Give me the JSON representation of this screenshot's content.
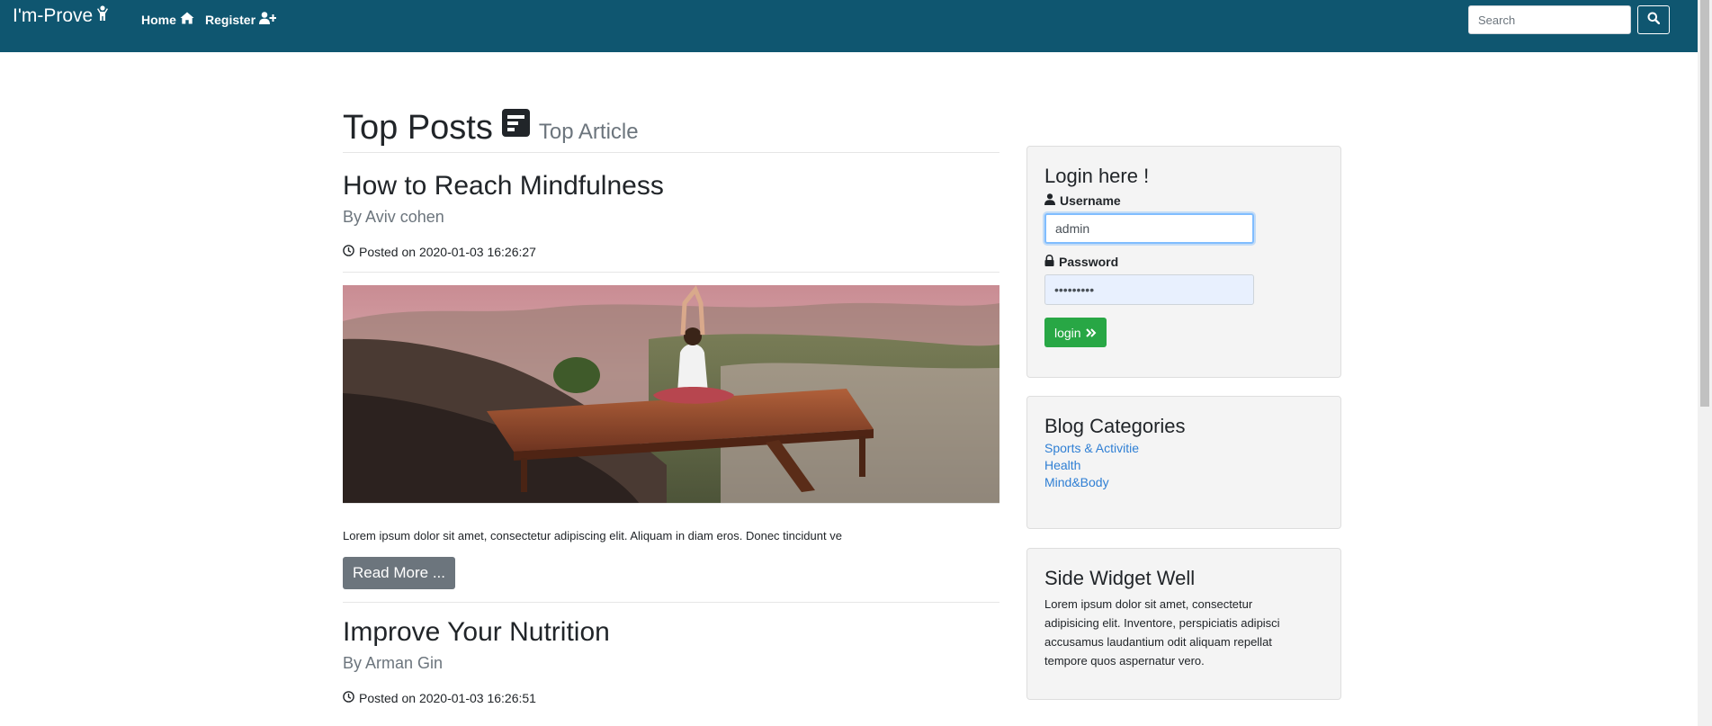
{
  "navbar": {
    "brand": "I'm-Prove",
    "links": [
      {
        "label": "Home",
        "icon": "home-icon"
      },
      {
        "label": "Register",
        "icon": "user-plus-icon"
      }
    ],
    "search_placeholder": "Search",
    "color": "#0f5670"
  },
  "main": {
    "section_title": "Top Posts",
    "section_subtitle": "Top Article",
    "posts": [
      {
        "title": "How to Reach Mindfulness",
        "author": "By Aviv cohen",
        "date": "Posted on 2020-01-03 16:26:27",
        "excerpt": "Lorem ipsum dolor sit amet, consectetur adipiscing elit. Aliquam in diam eros. Donec tincidunt ve",
        "read_more": "Read More ..."
      },
      {
        "title": "Improve Your Nutrition",
        "author": "By Arman Gin",
        "date": "Posted on 2020-01-03 16:26:51"
      }
    ]
  },
  "login": {
    "title": "Login here !",
    "username_label": "Username",
    "username_value": "admin",
    "password_label": "Password",
    "password_value": "•••••••••",
    "button_label": "login"
  },
  "categories": {
    "title": "Blog Categories",
    "items": [
      "Sports & Activitie",
      "Health",
      "Mind&Body"
    ]
  },
  "widget": {
    "title": "Side Widget Well",
    "text_lines": [
      "Lorem ipsum dolor sit amet, consectetur",
      "adipisicing elit. Inventore, perspiciatis adipisci",
      "accusamus laudantium odit aliquam repellat",
      "tempore quos aspernatur vero."
    ]
  },
  "colors": {
    "navbar": "#0f5670",
    "login_button": "#28a745",
    "read_more_button": "#6c757d",
    "link": "#2f7fd4"
  }
}
